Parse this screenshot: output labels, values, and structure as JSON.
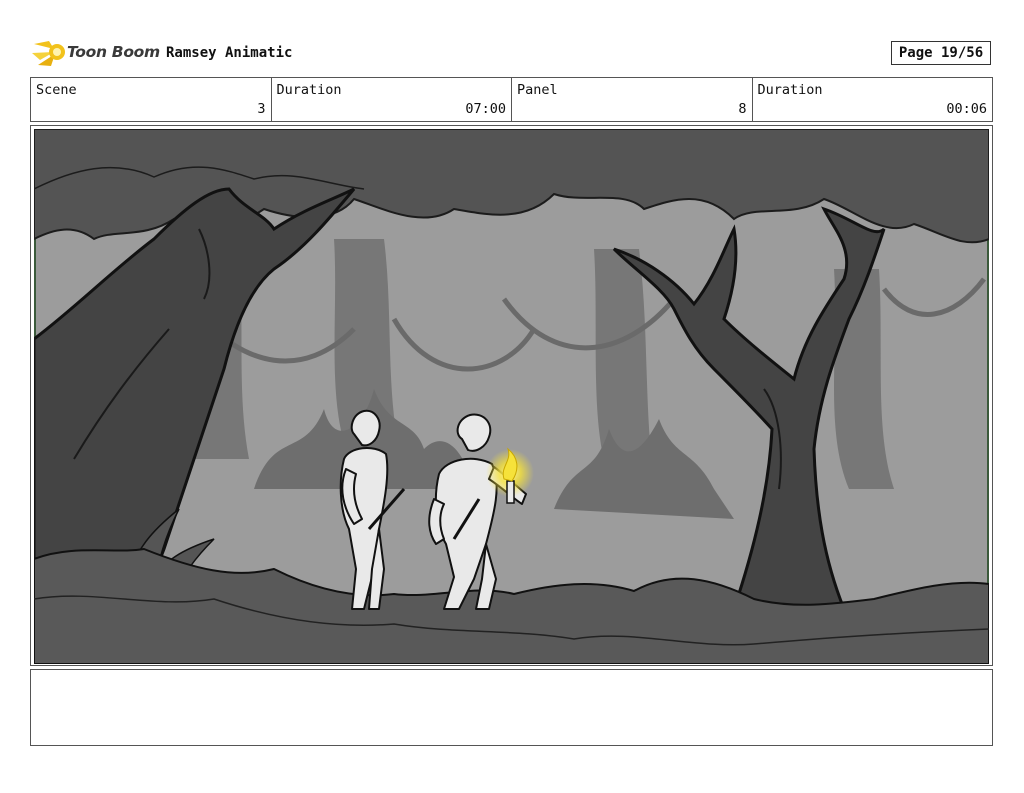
{
  "header": {
    "logo_text": "Toon Boom",
    "project_title": "Ramsey Animatic",
    "page_label": "Page 19/56"
  },
  "info": [
    {
      "label": "Scene",
      "value": "3"
    },
    {
      "label": "Duration",
      "value": "07:00"
    },
    {
      "label": "Panel",
      "value": "8"
    },
    {
      "label": "Duration",
      "value": "00:06"
    }
  ],
  "notes": {
    "text": ""
  },
  "colors": {
    "logo_accent": "#f2c21b",
    "sketch_frame": "#3b5a3b",
    "torch_glow": "#f6e23a"
  }
}
